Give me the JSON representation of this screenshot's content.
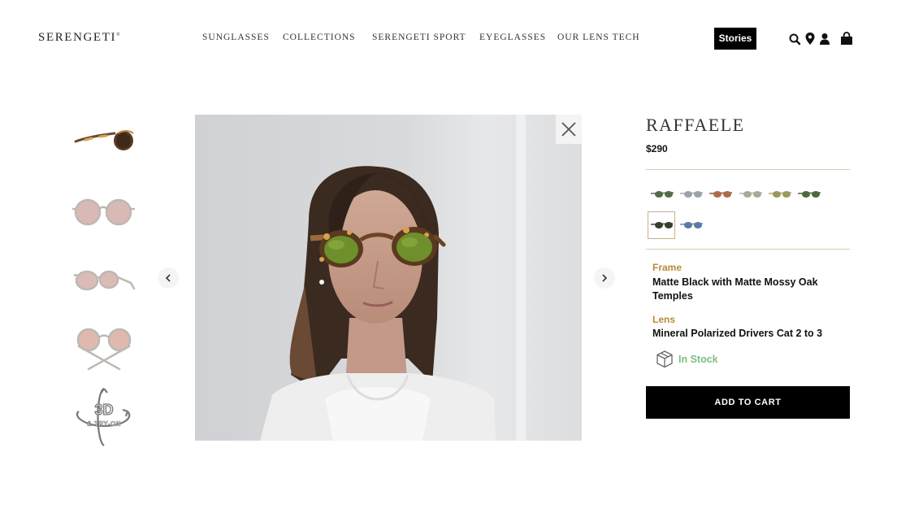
{
  "brand": {
    "logo_text": "SERENGETI"
  },
  "nav": {
    "items": [
      {
        "label": "SUNGLASSES"
      },
      {
        "label": "COLLECTIONS"
      },
      {
        "label": "SERENGETI SPORT"
      },
      {
        "label": "EYEGLASSES"
      },
      {
        "label": "OUR LENS TECH"
      }
    ],
    "stories_label": "Stories"
  },
  "header_icons": [
    "search-icon",
    "location-pin-icon",
    "account-icon",
    "shopping-bag-icon"
  ],
  "gallery": {
    "thumbnails": [
      "side-view",
      "front-view",
      "angled-view",
      "folded-view",
      "3d-try-on"
    ],
    "try_on_badge": {
      "line1": "3D",
      "line2": "& TRY-ON"
    }
  },
  "product": {
    "name": "RAFFAELE",
    "price": "$290",
    "frame_label": "Frame",
    "frame_value": "Matte Black with Matte Mossy Oak Temples",
    "lens_label": "Lens",
    "lens_value": "Mineral Polarized Drivers Cat 2 to 3",
    "stock_status": "In Stock",
    "add_to_cart_label": "ADD TO CART",
    "variant_count": 8,
    "selected_variant_index": 6
  },
  "colors": {
    "accent_gold": "#b8893a",
    "in_stock_green": "#7cbf83",
    "button_black": "#000000"
  }
}
